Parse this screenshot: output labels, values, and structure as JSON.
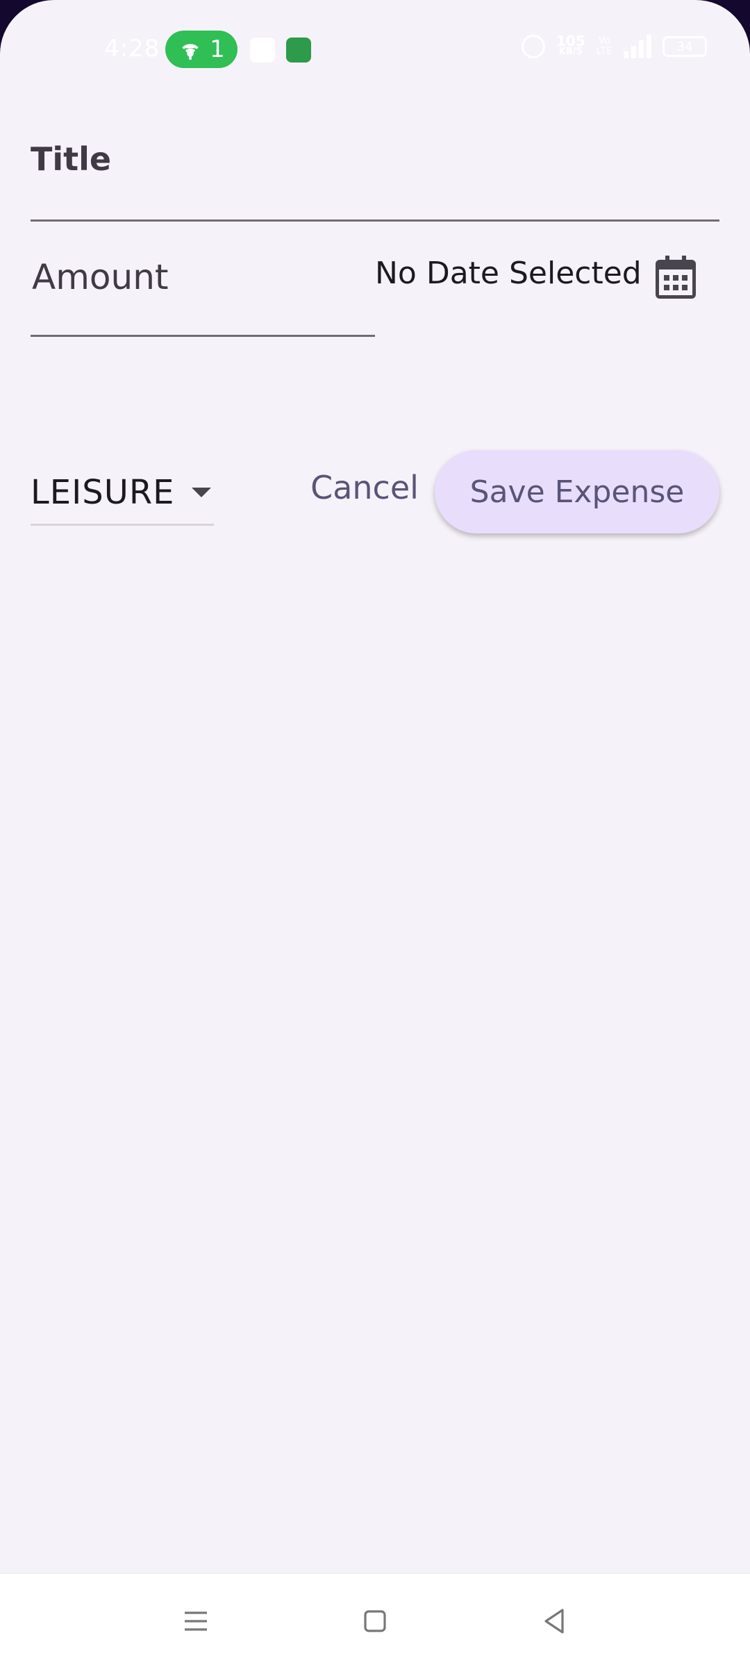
{
  "status_bar": {
    "time": "4:28",
    "hotspot_count": "1",
    "net_speed": "105",
    "net_speed_unit": "KB/S",
    "volte_top": "Vo",
    "volte_bottom": "LTE",
    "network_type": "4G",
    "battery": "34"
  },
  "form": {
    "title_label": "Title",
    "amount_label": "Amount",
    "date_text": "No Date Selected",
    "calendar_icon": "calendar-icon"
  },
  "actions": {
    "category_value": "LEISURE",
    "cancel_label": "Cancel",
    "save_label": "Save Expense"
  },
  "theme": {
    "background": "#f6f2f9",
    "primary_button": "#e8defb",
    "accent_text": "#5a5478",
    "underline": "#6f6a78"
  },
  "nav_bar": {
    "icons": [
      "menu-icon",
      "home-icon",
      "back-icon"
    ]
  }
}
